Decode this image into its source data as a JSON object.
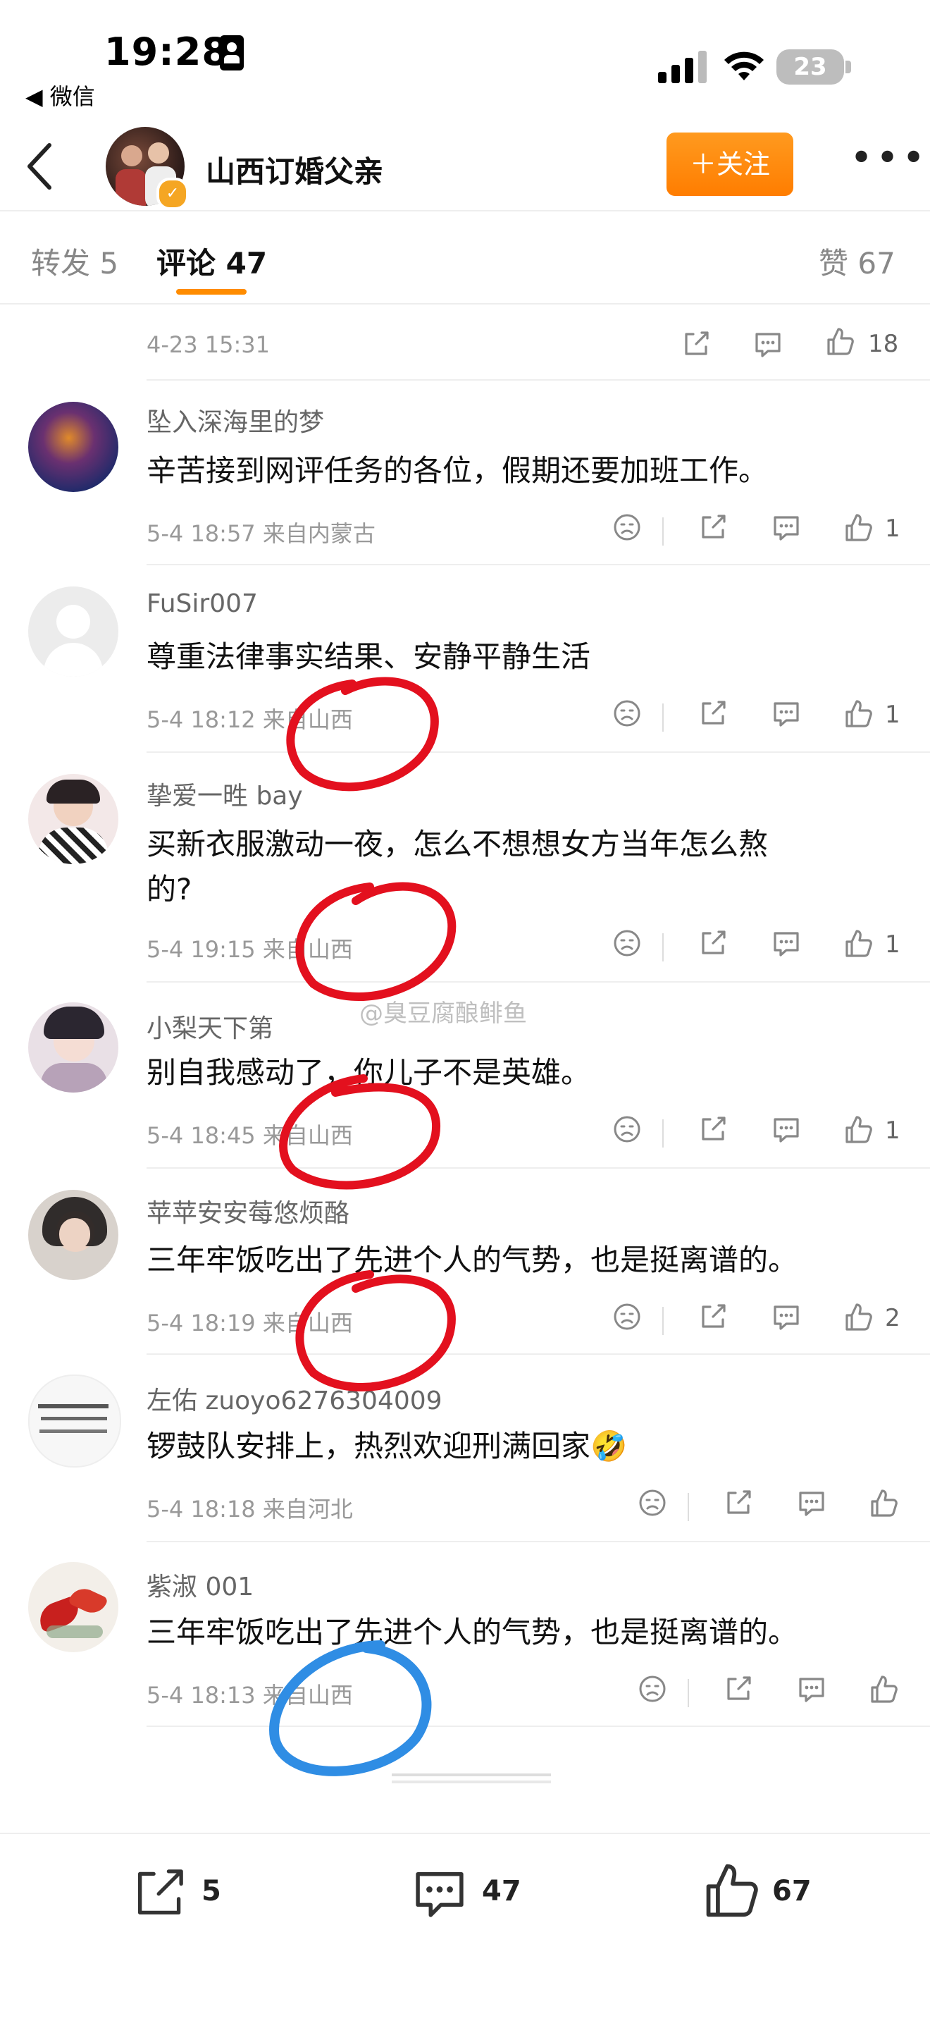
{
  "status_bar": {
    "time": "19:28",
    "back_label": "◀ 微信",
    "battery": "23"
  },
  "header": {
    "title": "山西订婚父亲",
    "follow_label": "＋关注",
    "more_label": "•••"
  },
  "tabs": {
    "repost": "转发 5",
    "comments": "评论 47",
    "likes": "赞 67"
  },
  "top_meta": {
    "time": "4-23 15:31",
    "likes": "18"
  },
  "comments": [
    {
      "user": "坠入深海里的梦",
      "text": "辛苦接到网评任务的各位，假期还要加班工作。",
      "meta": "5-4 18:57  来自内蒙古",
      "likes": "1"
    },
    {
      "user": "FuSir007",
      "text": "尊重法律事实结果、安静平静生活",
      "meta": "5-4 18:12  来自山西",
      "likes": "1"
    },
    {
      "user": "挚爱一甠 bay",
      "text": "买新衣服激动一夜，怎么不想想女方当年怎么熬的?",
      "text_line1": "买新衣服激动一夜，怎么不想想女方当年怎么熬",
      "text_line2": "的?",
      "meta": "5-4 19:15  来自山西",
      "likes": "1"
    },
    {
      "user": "小梨天下第",
      "text": "别自我感动了，你儿子不是英雄。",
      "meta": "5-4 18:45  来自山西",
      "likes": "1"
    },
    {
      "user": "苹苹安安莓悠烦酪",
      "text": "三年牢饭吃出了先进个人的气势，也是挺离谱的。",
      "meta": "5-4 18:19  来自山西",
      "likes": "2"
    },
    {
      "user": "左佑 zuoyo6276304009",
      "text": "锣鼓队安排上，热烈欢迎刑满回家🤣",
      "meta": "5-4 18:18  来自河北",
      "likes": ""
    },
    {
      "user": "紫淑 001",
      "text": "三年牢饭吃出了先进个人的气势，也是挺离谱的。",
      "meta": "5-4 18:13  来自山西",
      "likes": ""
    }
  ],
  "watermark": "@臭豆腐酿鲱鱼",
  "bottom_bar": {
    "reposts": "5",
    "comments": "47",
    "likes": "67"
  },
  "colors": {
    "accent": "#ff8c00",
    "red_mark": "#e3101e",
    "blue_mark": "#2f8de4"
  }
}
